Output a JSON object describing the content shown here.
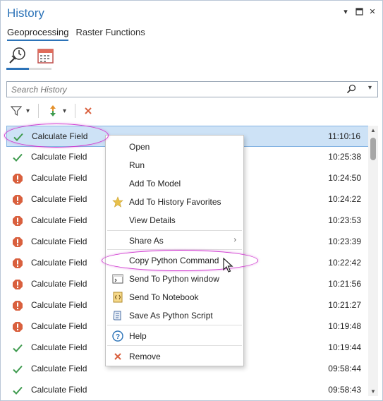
{
  "panel": {
    "title": "History",
    "tabs": [
      {
        "label": "Geoprocessing",
        "active": true
      },
      {
        "label": "Raster Functions",
        "active": false
      }
    ]
  },
  "views": [
    {
      "icon": "history-icon",
      "active": true
    },
    {
      "icon": "calendar-icon",
      "active": false
    }
  ],
  "search": {
    "placeholder": "Search History"
  },
  "toolbar": {
    "filter_icon": "filter-icon",
    "sort_icon": "sort-icon",
    "delete_icon": "delete-icon"
  },
  "rows": [
    {
      "name": "Calculate Field",
      "time": "11:10:16",
      "status": "success",
      "selected": true
    },
    {
      "name": "Calculate Field",
      "time": "10:25:38",
      "status": "success"
    },
    {
      "name": "Calculate Field",
      "time": "10:24:50",
      "status": "error"
    },
    {
      "name": "Calculate Field",
      "time": "10:24:22",
      "status": "error"
    },
    {
      "name": "Calculate Field",
      "time": "10:23:53",
      "status": "error"
    },
    {
      "name": "Calculate Field",
      "time": "10:23:39",
      "status": "error"
    },
    {
      "name": "Calculate Field",
      "time": "10:22:42",
      "status": "error"
    },
    {
      "name": "Calculate Field",
      "time": "10:21:56",
      "status": "error"
    },
    {
      "name": "Calculate Field",
      "time": "10:21:27",
      "status": "error"
    },
    {
      "name": "Calculate Field",
      "time": "10:19:48",
      "status": "error"
    },
    {
      "name": "Calculate Field",
      "time": "10:19:44",
      "status": "success"
    },
    {
      "name": "Calculate Field",
      "time": "09:58:44",
      "status": "success"
    },
    {
      "name": "Calculate Field",
      "time": "09:58:43",
      "status": "success"
    }
  ],
  "context_menu": {
    "items": [
      {
        "label": "Open"
      },
      {
        "label": "Run"
      },
      {
        "label": "Add To Model"
      },
      {
        "label": "Add To History Favorites",
        "icon": "star-icon"
      },
      {
        "label": "View Details"
      },
      {
        "label": "Share As",
        "submenu": true
      },
      {
        "label": "Copy Python Command"
      },
      {
        "label": "Send To Python window",
        "icon": "python-window-icon"
      },
      {
        "label": "Send To Notebook",
        "icon": "notebook-icon"
      },
      {
        "label": "Save As Python Script",
        "icon": "script-icon"
      },
      {
        "label": "Help",
        "icon": "help-icon"
      },
      {
        "label": "Remove",
        "icon": "remove-icon"
      }
    ]
  },
  "colors": {
    "accent": "#2c73b8",
    "success": "#3f9b4f",
    "error": "#d9603e",
    "highlight": "#d13fd1",
    "selection": "#cde2f6"
  }
}
